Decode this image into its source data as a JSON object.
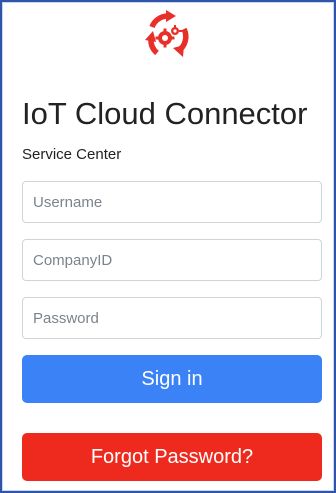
{
  "app": {
    "title": "IoT Cloud Connector",
    "subtitle": "Service Center",
    "logo_icon": "cloud-sync-gear-icon",
    "accent_color": "#e8302a"
  },
  "form": {
    "username_placeholder": "Username",
    "companyid_placeholder": "CompanyID",
    "password_placeholder": "Password",
    "username_value": "",
    "companyid_value": "",
    "password_value": ""
  },
  "buttons": {
    "signin_label": "Sign in",
    "signin_color": "#3b82f6",
    "forgot_label": "Forgot Password?",
    "forgot_color": "#ee2a1e"
  }
}
